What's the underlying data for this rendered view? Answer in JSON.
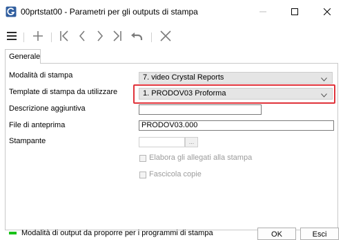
{
  "window": {
    "title": "00prtstat00 - Parametri per gli outputs di stampa",
    "app_icon": "app-g-icon"
  },
  "toolbar": {
    "icons": [
      "menu-icon",
      "add-icon",
      "first-icon",
      "previous-icon",
      "next-icon",
      "last-icon",
      "undo-icon",
      "delete-icon"
    ]
  },
  "tabs": [
    {
      "label": "Generale"
    }
  ],
  "form": {
    "mode_label": "Modalità di stampa",
    "mode_value": "7. video Crystal Reports",
    "template_label": "Template di stampa da utilizzare",
    "template_value": "1.  PRODOV03  Proforma",
    "description_label": "Descrizione aggiuntiva",
    "description_value": "",
    "preview_label": "File di anteprima",
    "preview_value": "PRODOV03.000",
    "printer_label": "Stampante",
    "printer_value": "",
    "browse_label": "...",
    "attach_label": "Elabora gli allegati alla stampa",
    "collate_label": "Fascicola copie",
    "attach_checked": false,
    "collate_checked": false
  },
  "status": {
    "text": "Modalità di output da proporre per i programmi di stampa",
    "color": "#19c219"
  },
  "buttons": {
    "ok": "OK",
    "exit": "Esci"
  },
  "accent": {
    "highlight": "#e0323a"
  }
}
